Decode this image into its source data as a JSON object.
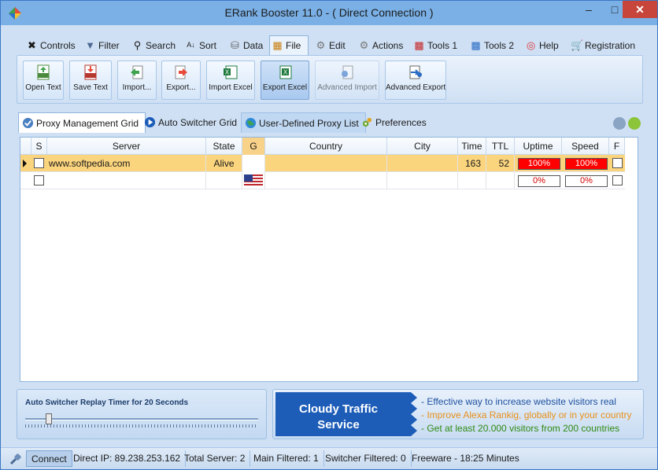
{
  "window": {
    "title": "ERank Booster 11.0 - ( Direct Connection )"
  },
  "menu": [
    {
      "label": "Controls",
      "icon": "tools-icon"
    },
    {
      "label": "Filter",
      "icon": "funnel-icon"
    },
    {
      "label": "Search",
      "icon": "magnifier-icon"
    },
    {
      "label": "Sort",
      "icon": "sort-az-icon"
    },
    {
      "label": "Data",
      "icon": "database-icon"
    },
    {
      "label": "File",
      "icon": "file-stack-icon"
    },
    {
      "label": "Edit",
      "icon": "gear-icon"
    },
    {
      "label": "Actions",
      "icon": "gear-icon"
    },
    {
      "label": "Tools 1",
      "icon": "toolbox-red-icon"
    },
    {
      "label": "Tools 2",
      "icon": "toolbox-blue-icon"
    },
    {
      "label": "Help",
      "icon": "lifebuoy-icon"
    },
    {
      "label": "Registration",
      "icon": "cart-icon"
    }
  ],
  "ribbon": [
    {
      "label": "Open Text",
      "icon": "txt-open-icon"
    },
    {
      "label": "Save Text",
      "icon": "txt-save-icon"
    },
    {
      "label": "Import...",
      "icon": "import-icon"
    },
    {
      "label": "Export...",
      "icon": "export-icon"
    },
    {
      "label": "Import Excel",
      "icon": "excel-import-icon"
    },
    {
      "label": "Export Excel",
      "icon": "excel-export-icon"
    },
    {
      "label": "Advanced Import",
      "icon": "advanced-import-icon"
    },
    {
      "label": "Advanced Export",
      "icon": "advanced-export-icon"
    }
  ],
  "tabs": [
    {
      "label": "Proxy Management Grid",
      "icon": "check-shield-icon"
    },
    {
      "label": "Auto Switcher Grid",
      "icon": "play-icon"
    },
    {
      "label": "User-Defined Proxy List",
      "icon": "globe-icon"
    },
    {
      "label": "Preferences",
      "icon": "gears-icon"
    }
  ],
  "grid": {
    "columns": [
      "S",
      "Server",
      "State",
      "G",
      "Country",
      "City",
      "Time",
      "TTL",
      "Uptime",
      "Speed",
      "F"
    ],
    "rows": [
      {
        "server": "www.softpedia.com",
        "state": "Alive",
        "country": "",
        "city": "",
        "time": "163",
        "ttl": "52",
        "uptime": "100%",
        "speed": "100%",
        "selected": true,
        "flag": "blank"
      },
      {
        "server": "",
        "state": "",
        "country": "",
        "city": "",
        "time": "",
        "ttl": "",
        "uptime": "0%",
        "speed": "0%",
        "selected": false,
        "flag": "us"
      }
    ]
  },
  "timer": {
    "label": "Auto Switcher Replay Timer for 20 Seconds",
    "level": 0.1
  },
  "ad": {
    "title_line1": "Cloudy Traffic",
    "title_line2": "Service",
    "lines": [
      {
        "text": "- Effective way to increase website visitors real",
        "color": "#1d4f9e"
      },
      {
        "text": "- Improve Alexa Rankig, globally or in your country",
        "color": "#e8901a"
      },
      {
        "text": "- Get at least 20.000 visitors from 200 countries",
        "color": "#2f8a12"
      }
    ]
  },
  "status": {
    "connect": "Connect",
    "direct_ip": "Direct IP: 89.238.253.162",
    "total": "Total Server: 2",
    "main_filtered": "Main Filtered: 1",
    "switcher_filtered": "Switcher Filtered: 0",
    "freeware": "Freeware - 18:25 Minutes"
  },
  "colors": {
    "accent": "#1d5db8",
    "selected_row": "#fbd47e",
    "alert": "#ff0000"
  }
}
